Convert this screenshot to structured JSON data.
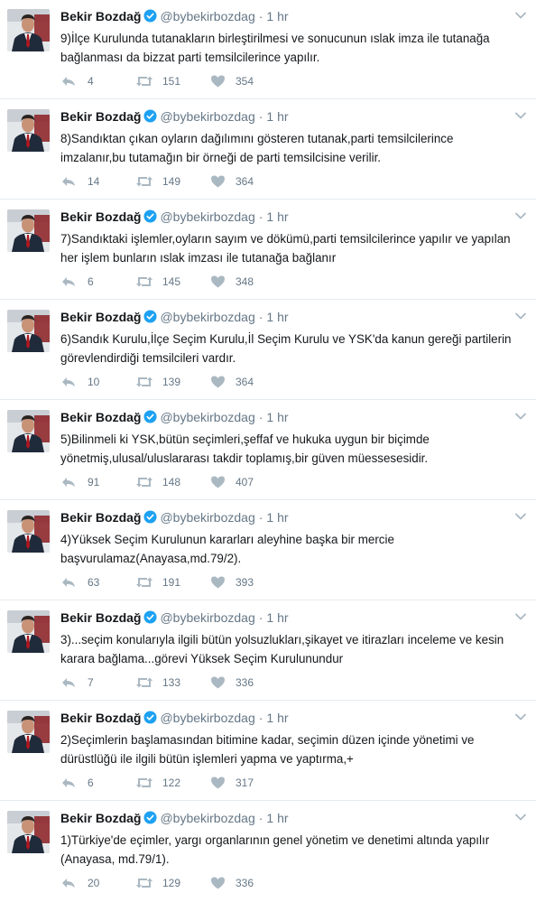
{
  "colors": {
    "text": "#14171a",
    "muted": "#657786",
    "icon": "#aab8c2",
    "verified": "#1da1f2",
    "divider": "#e6ecf0"
  },
  "icons": {
    "verified": "verified-badge-icon",
    "caret": "chevron-down-icon",
    "reply": "reply-icon",
    "retweet": "retweet-icon",
    "like": "heart-icon"
  },
  "tweets": [
    {
      "name": "Bekir Bozdağ",
      "handle": "@bybekirbozdag",
      "separator": "·",
      "time": "1 hr",
      "text": "9)İlçe Kurulunda tutanakların birleştirilmesi ve sonucunun ıslak imza ile tutanağa bağlanması da bizzat parti temsilcilerince yapılır.",
      "replies": "4",
      "retweets": "151",
      "likes": "354"
    },
    {
      "name": "Bekir Bozdağ",
      "handle": "@bybekirbozdag",
      "separator": "·",
      "time": "1 hr",
      "text": "8)Sandıktan çıkan oyların dağılımını gösteren tutanak,parti temsilcilerince imzalanır,bu tutamağın bir örneği de parti temsilcisine verilir.",
      "replies": "14",
      "retweets": "149",
      "likes": "364"
    },
    {
      "name": "Bekir Bozdağ",
      "handle": "@bybekirbozdag",
      "separator": "·",
      "time": "1 hr",
      "text": "7)Sandıktaki işlemler,oyların sayım ve dökümü,parti temsilcilerince yapılır ve yapılan her işlem bunların ıslak imzası ile tutanağa bağlanır",
      "replies": "6",
      "retweets": "145",
      "likes": "348"
    },
    {
      "name": "Bekir Bozdağ",
      "handle": "@bybekirbozdag",
      "separator": "·",
      "time": "1 hr",
      "text": "6)Sandık Kurulu,İlçe Seçim Kurulu,İl Seçim Kurulu ve YSK'da kanun gereği partilerin görevlendirdiği temsilcileri vardır.",
      "replies": "10",
      "retweets": "139",
      "likes": "364"
    },
    {
      "name": "Bekir Bozdağ",
      "handle": "@bybekirbozdag",
      "separator": "·",
      "time": "1 hr",
      "text": "5)Bilinmeli ki YSK,bütün seçimleri,şeffaf ve hukuka uygun bir biçimde yönetmiş,ulusal/uluslararası takdir toplamış,bir güven müessesesidir.",
      "replies": "91",
      "retweets": "148",
      "likes": "407"
    },
    {
      "name": "Bekir Bozdağ",
      "handle": "@bybekirbozdag",
      "separator": "·",
      "time": "1 hr",
      "text": "4)Yüksek Seçim Kurulunun kararları aleyhine başka bir mercie başvurulamaz(Anayasa,md.79/2).",
      "replies": "63",
      "retweets": "191",
      "likes": "393"
    },
    {
      "name": "Bekir Bozdağ",
      "handle": "@bybekirbozdag",
      "separator": "·",
      "time": "1 hr",
      "text": "3)...seçim konularıyla ilgili bütün yolsuzlukları,şikayet ve itirazları inceleme ve kesin karara bağlama...görevi Yüksek Seçim Kurulunundur",
      "replies": "7",
      "retweets": "133",
      "likes": "336"
    },
    {
      "name": "Bekir Bozdağ",
      "handle": "@bybekirbozdag",
      "separator": "·",
      "time": "1 hr",
      "text": "2)Seçimlerin başlamasından bitimine kadar, seçimin düzen içinde yönetimi ve dürüstlüğü ile ilgili bütün işlemleri yapma ve yaptırma,+",
      "replies": "6",
      "retweets": "122",
      "likes": "317"
    },
    {
      "name": "Bekir Bozdağ",
      "handle": "@bybekirbozdag",
      "separator": "·",
      "time": "1 hr",
      "text": "1)Türkiye'de eçimler, yargı organlarının genel yönetim ve denetimi altında yapılır (Anayasa, md.79/1).",
      "replies": "20",
      "retweets": "129",
      "likes": "336"
    }
  ]
}
